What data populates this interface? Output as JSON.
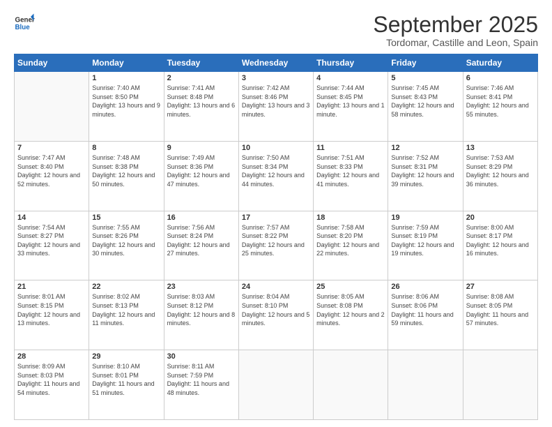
{
  "header": {
    "logo": {
      "line1": "General",
      "line2": "Blue"
    },
    "title": "September 2025",
    "location": "Tordomar, Castille and Leon, Spain"
  },
  "weekdays": [
    "Sunday",
    "Monday",
    "Tuesday",
    "Wednesday",
    "Thursday",
    "Friday",
    "Saturday"
  ],
  "weeks": [
    [
      null,
      {
        "day": 1,
        "sunrise": "Sunrise: 7:40 AM",
        "sunset": "Sunset: 8:50 PM",
        "daylight": "Daylight: 13 hours and 9 minutes."
      },
      {
        "day": 2,
        "sunrise": "Sunrise: 7:41 AM",
        "sunset": "Sunset: 8:48 PM",
        "daylight": "Daylight: 13 hours and 6 minutes."
      },
      {
        "day": 3,
        "sunrise": "Sunrise: 7:42 AM",
        "sunset": "Sunset: 8:46 PM",
        "daylight": "Daylight: 13 hours and 3 minutes."
      },
      {
        "day": 4,
        "sunrise": "Sunrise: 7:44 AM",
        "sunset": "Sunset: 8:45 PM",
        "daylight": "Daylight: 13 hours and 1 minute."
      },
      {
        "day": 5,
        "sunrise": "Sunrise: 7:45 AM",
        "sunset": "Sunset: 8:43 PM",
        "daylight": "Daylight: 12 hours and 58 minutes."
      },
      {
        "day": 6,
        "sunrise": "Sunrise: 7:46 AM",
        "sunset": "Sunset: 8:41 PM",
        "daylight": "Daylight: 12 hours and 55 minutes."
      }
    ],
    [
      {
        "day": 7,
        "sunrise": "Sunrise: 7:47 AM",
        "sunset": "Sunset: 8:40 PM",
        "daylight": "Daylight: 12 hours and 52 minutes."
      },
      {
        "day": 8,
        "sunrise": "Sunrise: 7:48 AM",
        "sunset": "Sunset: 8:38 PM",
        "daylight": "Daylight: 12 hours and 50 minutes."
      },
      {
        "day": 9,
        "sunrise": "Sunrise: 7:49 AM",
        "sunset": "Sunset: 8:36 PM",
        "daylight": "Daylight: 12 hours and 47 minutes."
      },
      {
        "day": 10,
        "sunrise": "Sunrise: 7:50 AM",
        "sunset": "Sunset: 8:34 PM",
        "daylight": "Daylight: 12 hours and 44 minutes."
      },
      {
        "day": 11,
        "sunrise": "Sunrise: 7:51 AM",
        "sunset": "Sunset: 8:33 PM",
        "daylight": "Daylight: 12 hours and 41 minutes."
      },
      {
        "day": 12,
        "sunrise": "Sunrise: 7:52 AM",
        "sunset": "Sunset: 8:31 PM",
        "daylight": "Daylight: 12 hours and 39 minutes."
      },
      {
        "day": 13,
        "sunrise": "Sunrise: 7:53 AM",
        "sunset": "Sunset: 8:29 PM",
        "daylight": "Daylight: 12 hours and 36 minutes."
      }
    ],
    [
      {
        "day": 14,
        "sunrise": "Sunrise: 7:54 AM",
        "sunset": "Sunset: 8:27 PM",
        "daylight": "Daylight: 12 hours and 33 minutes."
      },
      {
        "day": 15,
        "sunrise": "Sunrise: 7:55 AM",
        "sunset": "Sunset: 8:26 PM",
        "daylight": "Daylight: 12 hours and 30 minutes."
      },
      {
        "day": 16,
        "sunrise": "Sunrise: 7:56 AM",
        "sunset": "Sunset: 8:24 PM",
        "daylight": "Daylight: 12 hours and 27 minutes."
      },
      {
        "day": 17,
        "sunrise": "Sunrise: 7:57 AM",
        "sunset": "Sunset: 8:22 PM",
        "daylight": "Daylight: 12 hours and 25 minutes."
      },
      {
        "day": 18,
        "sunrise": "Sunrise: 7:58 AM",
        "sunset": "Sunset: 8:20 PM",
        "daylight": "Daylight: 12 hours and 22 minutes."
      },
      {
        "day": 19,
        "sunrise": "Sunrise: 7:59 AM",
        "sunset": "Sunset: 8:19 PM",
        "daylight": "Daylight: 12 hours and 19 minutes."
      },
      {
        "day": 20,
        "sunrise": "Sunrise: 8:00 AM",
        "sunset": "Sunset: 8:17 PM",
        "daylight": "Daylight: 12 hours and 16 minutes."
      }
    ],
    [
      {
        "day": 21,
        "sunrise": "Sunrise: 8:01 AM",
        "sunset": "Sunset: 8:15 PM",
        "daylight": "Daylight: 12 hours and 13 minutes."
      },
      {
        "day": 22,
        "sunrise": "Sunrise: 8:02 AM",
        "sunset": "Sunset: 8:13 PM",
        "daylight": "Daylight: 12 hours and 11 minutes."
      },
      {
        "day": 23,
        "sunrise": "Sunrise: 8:03 AM",
        "sunset": "Sunset: 8:12 PM",
        "daylight": "Daylight: 12 hours and 8 minutes."
      },
      {
        "day": 24,
        "sunrise": "Sunrise: 8:04 AM",
        "sunset": "Sunset: 8:10 PM",
        "daylight": "Daylight: 12 hours and 5 minutes."
      },
      {
        "day": 25,
        "sunrise": "Sunrise: 8:05 AM",
        "sunset": "Sunset: 8:08 PM",
        "daylight": "Daylight: 12 hours and 2 minutes."
      },
      {
        "day": 26,
        "sunrise": "Sunrise: 8:06 AM",
        "sunset": "Sunset: 8:06 PM",
        "daylight": "Daylight: 11 hours and 59 minutes."
      },
      {
        "day": 27,
        "sunrise": "Sunrise: 8:08 AM",
        "sunset": "Sunset: 8:05 PM",
        "daylight": "Daylight: 11 hours and 57 minutes."
      }
    ],
    [
      {
        "day": 28,
        "sunrise": "Sunrise: 8:09 AM",
        "sunset": "Sunset: 8:03 PM",
        "daylight": "Daylight: 11 hours and 54 minutes."
      },
      {
        "day": 29,
        "sunrise": "Sunrise: 8:10 AM",
        "sunset": "Sunset: 8:01 PM",
        "daylight": "Daylight: 11 hours and 51 minutes."
      },
      {
        "day": 30,
        "sunrise": "Sunrise: 8:11 AM",
        "sunset": "Sunset: 7:59 PM",
        "daylight": "Daylight: 11 hours and 48 minutes."
      },
      null,
      null,
      null,
      null
    ]
  ]
}
